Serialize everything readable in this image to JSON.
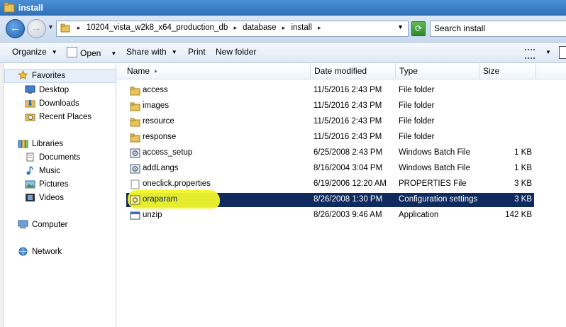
{
  "window": {
    "title": "install"
  },
  "address": {
    "crumbs": [
      "10204_vista_w2k8_x64_production_db",
      "database",
      "install"
    ],
    "search_placeholder": "Search install"
  },
  "toolbar": {
    "organize": "Organize",
    "open": "Open",
    "share_with": "Share with",
    "print": "Print",
    "new_folder": "New folder"
  },
  "nav": {
    "favorites": {
      "label": "Favorites",
      "items": [
        "Desktop",
        "Downloads",
        "Recent Places"
      ]
    },
    "libraries": {
      "label": "Libraries",
      "items": [
        "Documents",
        "Music",
        "Pictures",
        "Videos"
      ]
    },
    "computer": "Computer",
    "network": "Network"
  },
  "columns": {
    "name": "Name",
    "date": "Date modified",
    "type": "Type",
    "size": "Size"
  },
  "files": [
    {
      "name": "access",
      "date": "11/5/2016 2:43 PM",
      "type": "File folder",
      "size": "",
      "icon": "folder-icon"
    },
    {
      "name": "images",
      "date": "11/5/2016 2:43 PM",
      "type": "File folder",
      "size": "",
      "icon": "folder-icon"
    },
    {
      "name": "resource",
      "date": "11/5/2016 2:43 PM",
      "type": "File folder",
      "size": "",
      "icon": "folder-icon"
    },
    {
      "name": "response",
      "date": "11/5/2016 2:43 PM",
      "type": "File folder",
      "size": "",
      "icon": "folder-icon"
    },
    {
      "name": "access_setup",
      "date": "6/25/2008 2:43 PM",
      "type": "Windows Batch File",
      "size": "1 KB",
      "icon": "batch-file-icon"
    },
    {
      "name": "addLangs",
      "date": "8/16/2004 3:04 PM",
      "type": "Windows Batch File",
      "size": "1 KB",
      "icon": "batch-file-icon"
    },
    {
      "name": "oneclick.properties",
      "date": "6/19/2006 12:20 AM",
      "type": "PROPERTIES File",
      "size": "3 KB",
      "icon": "document-icon"
    },
    {
      "name": "oraparam",
      "date": "8/26/2008 1:30 PM",
      "type": "Configuration settings",
      "size": "3 KB",
      "icon": "config-file-icon",
      "selected": true
    },
    {
      "name": "unzip",
      "date": "8/26/2003 9:46 AM",
      "type": "Application",
      "size": "142 KB",
      "icon": "application-icon"
    }
  ],
  "colors": {
    "selection": "#0f2a5e",
    "highlight": "#f1f52a",
    "title_bar": "#2f6fb8"
  }
}
